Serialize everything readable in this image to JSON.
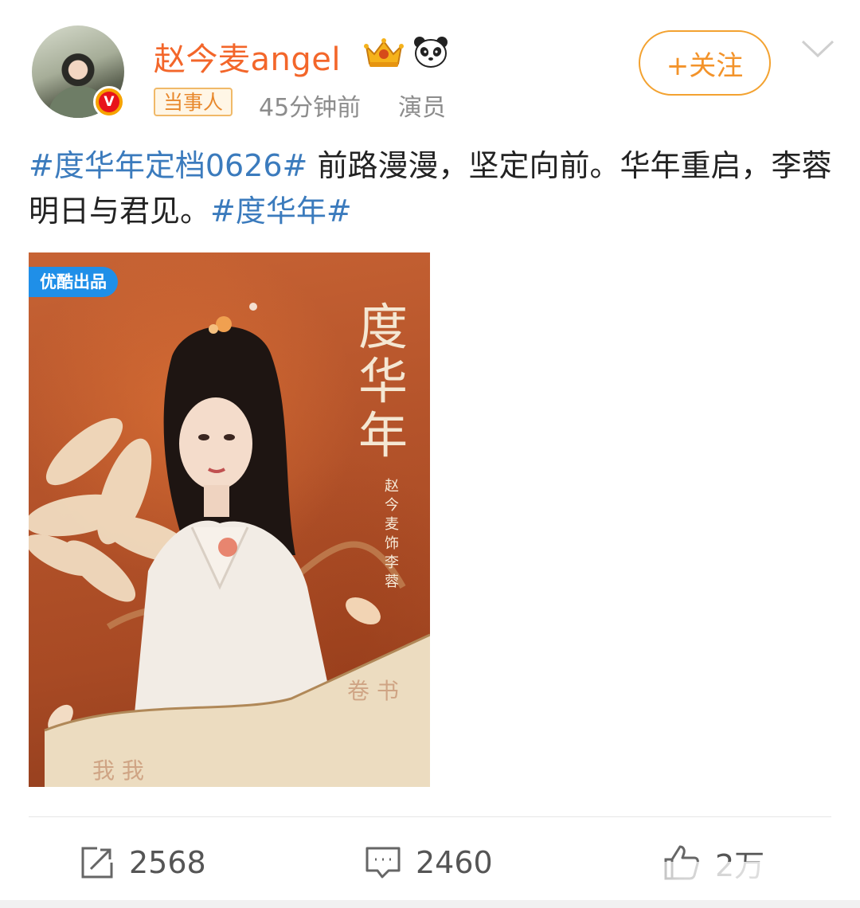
{
  "author": {
    "name": "赵今麦angel",
    "verified_badge": "V",
    "tag": "当事人",
    "time": "45分钟前",
    "role": "演员",
    "avatar_icon": "user-avatar"
  },
  "follow_button": {
    "label": "+关注"
  },
  "post": {
    "hashtag1": "#度华年定档0626#",
    "text": " 前路漫漫，坚定向前。华年重启，李蓉明日与君见。",
    "hashtag2": "#度华年#"
  },
  "poster": {
    "badge": "优酷出品",
    "title_chars": [
      "度",
      "华",
      "年"
    ],
    "credit": "赵今麦饰李蓉"
  },
  "actions": {
    "repost_count": "2568",
    "comment_count": "2460",
    "like_count": "2万"
  },
  "colors": {
    "username": "#f3662a",
    "hashtag": "#3b7bbd",
    "follow": "#f3a230"
  }
}
